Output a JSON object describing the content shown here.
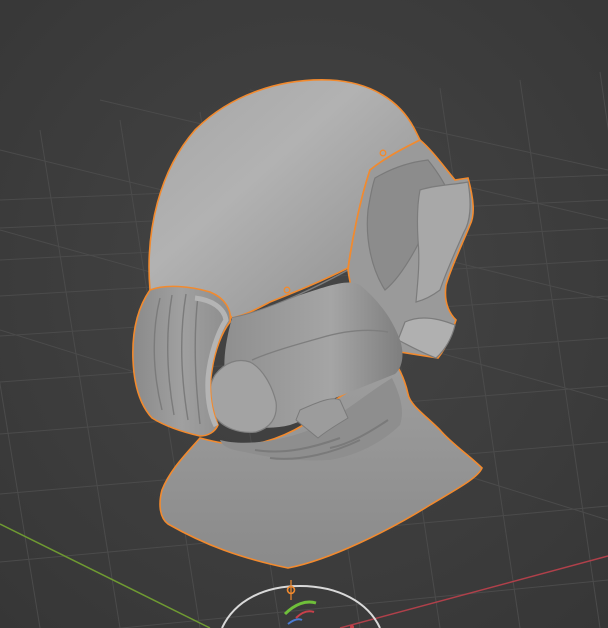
{
  "app": {
    "view": "3D Viewport",
    "shading_mode": "solid"
  },
  "scene": {
    "selected_object": "helmet-mesh",
    "selection_state": "active",
    "selection_outline_color": "#f28a2e",
    "mesh_color": "#9c9c9c",
    "background_color": "#3d3d3d",
    "grid_color": "#4a4a4a",
    "x_axis_color": "#b0404a",
    "y_axis_color": "#6f9a32"
  },
  "gizmo": {
    "transform_ring_color": "#d9d9d9",
    "origin_point_color": "#f28a2e"
  }
}
